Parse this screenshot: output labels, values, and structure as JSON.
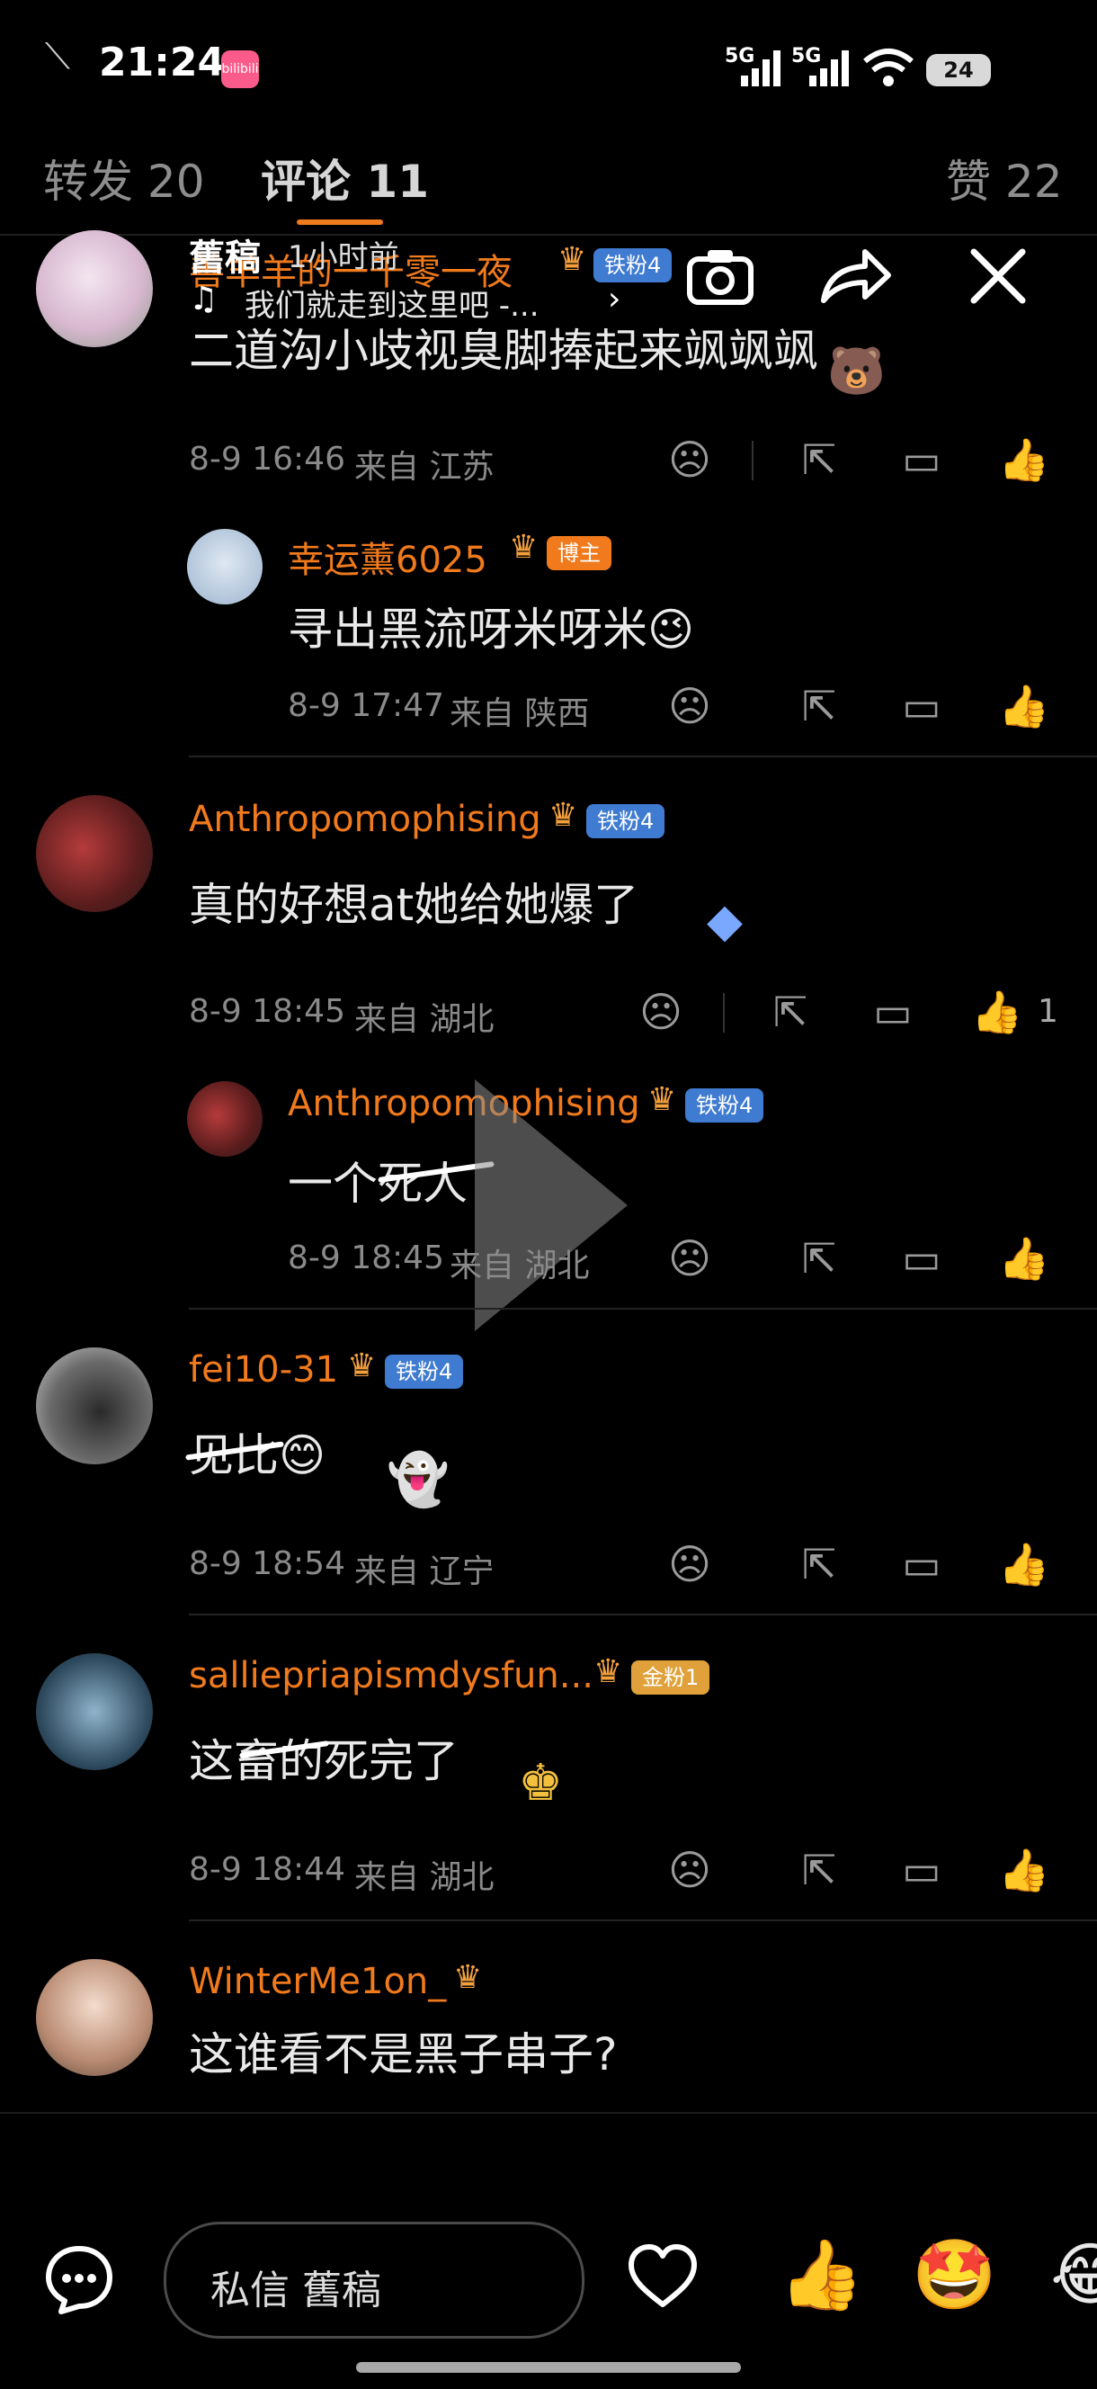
{
  "status": {
    "time": "21:24",
    "app_badge": "bilibili",
    "net1": "5G",
    "net2": "5G",
    "battery": "24"
  },
  "tabs": [
    {
      "label": "转发 20"
    },
    {
      "label": "评论 11"
    },
    {
      "label": "赞 22"
    }
  ],
  "overlay": {
    "title": "舊稿",
    "time": "1小时前",
    "music": "我们就走到这里吧 -..."
  },
  "comments": [
    {
      "user": "善羊羊的一千零一夜",
      "badge": "铁粉4",
      "text": "二道沟小歧视臭脚捧起来飒飒飒",
      "date": "8-9 16:46",
      "from": "来自 江苏",
      "likes": ""
    },
    {
      "user": "幸运薰6025",
      "badge": "博主",
      "text": "寻出黑流呀米呀米😉",
      "date": "8-9 17:47",
      "from": "来自 陕西",
      "likes": ""
    },
    {
      "user": "Anthropomophising",
      "badge": "铁粉4",
      "text": "真的好想at她给她爆了",
      "date": "8-9 18:45",
      "from": "来自 湖北",
      "likes": "1"
    },
    {
      "user": "Anthropomophising",
      "badge": "铁粉4",
      "text": "一个死人",
      "date": "8-9 18:45",
      "from": "来自 湖北",
      "likes": ""
    },
    {
      "user": "fei10-31",
      "badge": "铁粉4",
      "text": "见比😊",
      "date": "8-9 18:54",
      "from": "来自 辽宁",
      "likes": ""
    },
    {
      "user": "salliepriapismdysfun...",
      "badge": "金粉1",
      "text": "这畜的死完了",
      "date": "8-9 18:44",
      "from": "来自 湖北",
      "likes": ""
    },
    {
      "user": "WinterMe1on_",
      "badge": "",
      "text": "这谁看不是黑子串子?",
      "date": "",
      "from": "",
      "likes": ""
    }
  ],
  "bottom": {
    "dm_placeholder": "私信 舊稿"
  }
}
